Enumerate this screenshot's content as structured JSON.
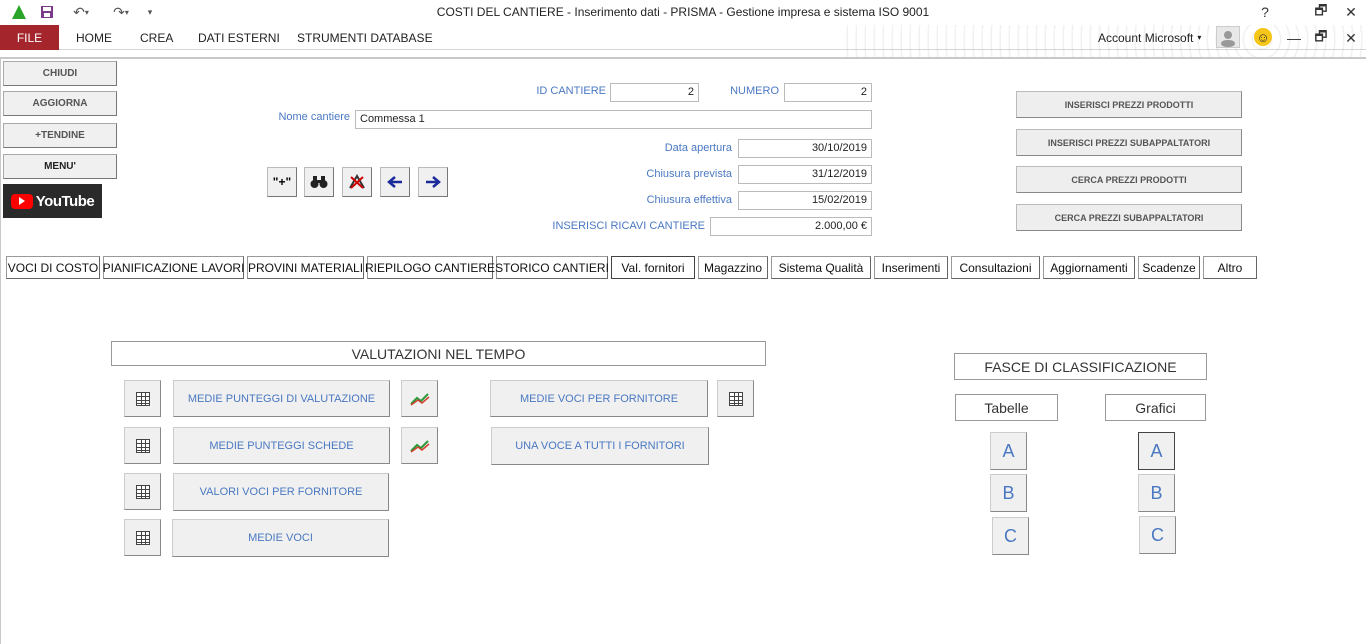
{
  "window": {
    "title": "COSTI DEL CANTIERE - Inserimento dati - PRISMA - Gestione impresa e sistema ISO 9001",
    "help": "?",
    "restore": "🗗",
    "close": "✕",
    "minimize": "—"
  },
  "ribbon": {
    "file": "FILE",
    "tabs": [
      "HOME",
      "CREA",
      "DATI ESTERNI",
      "STRUMENTI DATABASE"
    ],
    "account": "Account Microsoft",
    "smiley": "☺"
  },
  "sidebar": {
    "chiudi": "CHIUDI",
    "aggiorna": "AGGIORNA",
    "tendine": "+TENDINE",
    "menu": "MENU'",
    "youtube": "YouTube"
  },
  "header": {
    "id_label": "ID CANTIERE",
    "id_value": "2",
    "numero_label": "NUMERO",
    "numero_value": "2",
    "nome_label": "Nome cantiere",
    "nome_value": "Commessa 1",
    "apertura_label": "Data apertura",
    "apertura_value": "30/10/2019",
    "prevista_label": "Chiusura prevista",
    "prevista_value": "31/12/2019",
    "effettiva_label": "Chiusura effettiva",
    "effettiva_value": "15/02/2019",
    "ricavi_label": "INSERISCI RICAVI CANTIERE",
    "ricavi_value": "2.000,00 €",
    "nav_add": "\"+\""
  },
  "actions": {
    "prezzi_prodotti": "INSERISCI PREZZI PRODOTTI",
    "prezzi_sub": "INSERISCI PREZZI SUBAPPALTATORI",
    "cerca_prodotti": "CERCA PREZZI PRODOTTI",
    "cerca_sub": "CERCA PREZZI SUBAPPALTATORI"
  },
  "tabs": [
    "VOCI DI COSTO",
    "PIANIFICAZIONE LAVORI",
    "PROVINI MATERIALI",
    "RIEPILOGO CANTIERE",
    "STORICO CANTIERI",
    "Val. fornitori",
    "Magazzino",
    "Sistema Qualità",
    "Inserimenti",
    "Consultazioni",
    "Aggiornamenti",
    "Scadenze",
    "Altro"
  ],
  "valutazioni": {
    "title": "VALUTAZIONI NEL TEMPO",
    "medie_punteggi": "MEDIE PUNTEGGI DI VALUTAZIONE",
    "medie_schede": "MEDIE PUNTEGGI SCHEDE",
    "valori_voci": "VALORI VOCI PER FORNITORE",
    "medie_voci": "MEDIE VOCI",
    "medie_voci_fornitore": "MEDIE VOCI PER FORNITORE",
    "una_voce": "UNA VOCE A TUTTI I FORNITORI"
  },
  "fasce": {
    "title": "FASCE DI CLASSIFICAZIONE",
    "tabelle": "Tabelle",
    "grafici": "Grafici",
    "a": "A",
    "b": "B",
    "c": "C"
  }
}
